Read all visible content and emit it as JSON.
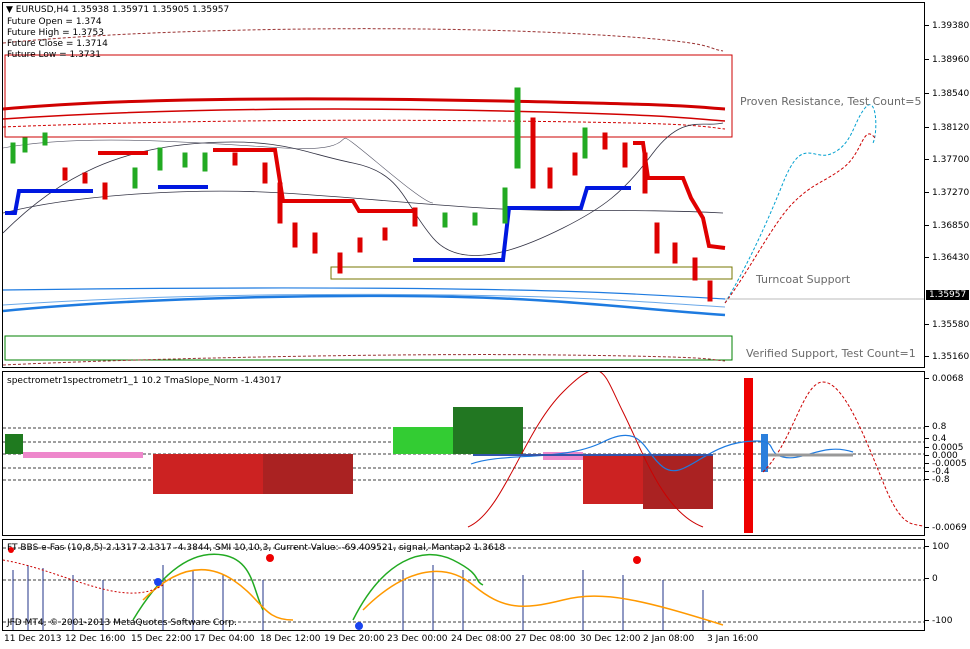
{
  "header": {
    "symbol": "EURUSD,H4",
    "ohlc": "1.35938 1.35971 1.35905 1.35957",
    "future_open": "Future Open = 1.374",
    "future_high": "Future High = 1.3753",
    "future_close": "Future Close = 1.3714",
    "future_low": "Future Low = 1.3731"
  },
  "main_chart": {
    "price_ticks": [
      "1.39380",
      "1.38960",
      "1.38540",
      "1.38120",
      "1.37700",
      "1.37270",
      "1.36850",
      "1.36430",
      "1.35580",
      "1.35160"
    ],
    "current_price": "1.35957",
    "resistance_label": "Proven Resistance, Test Count=5",
    "turncoat_label": "Turncoat Support",
    "verified_label": "Verified Support, Test Count=1"
  },
  "indicator1": {
    "title": "spectrometr1spectrometr1_1  10.2 TmaSlope_Norm -1.43017",
    "ticks": [
      "0.0068",
      "0.8",
      "0.4",
      "0.0005",
      "0.000",
      "-0.0005",
      "-0.4",
      "-0.8",
      "-0.0069"
    ]
  },
  "indicator2": {
    "title": "FT BBS e-Fas (10,8,5) 2.1317 2.1317 -4.3844, SMI 10,10,3, Current Value: -69.409521, signal, Mantap2 1.3618",
    "ticks": [
      "100",
      "0",
      "-100"
    ],
    "copyright": "JFD MT4, © 2001-2013 MetaQuotes Software Corp."
  },
  "time_axis": [
    "11 Dec 2013",
    "12 Dec 16:00",
    "15 Dec 22:00",
    "17 Dec 04:00",
    "18 Dec 12:00",
    "19 Dec 20:00",
    "23 Dec 00:00",
    "24 Dec 08:00",
    "27 Dec 08:00",
    "30 Dec 12:00",
    "2 Jan 08:00",
    "3 Jan 16:00"
  ],
  "colors": {
    "resistance": "#d00000",
    "support_blue": "#0000ff",
    "bull_candle": "#22aa22",
    "bear_candle": "#dd0000",
    "zone_red": "#cc0000",
    "zone_green": "#008000"
  }
}
